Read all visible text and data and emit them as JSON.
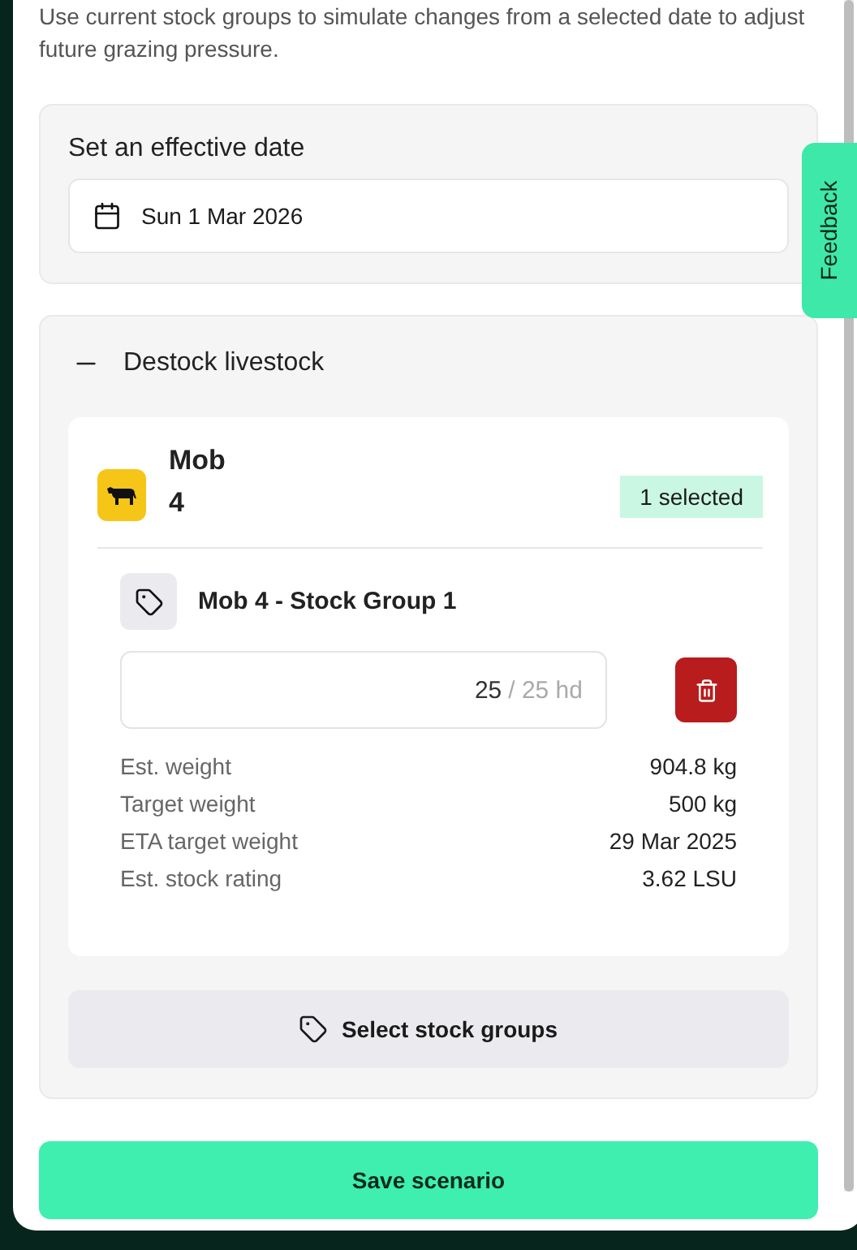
{
  "intro": "Use current stock groups to simulate changes from a selected date to adjust future grazing pressure.",
  "effective_date": {
    "label": "Set an effective date",
    "value": "Sun 1 Mar 2026"
  },
  "destock": {
    "title": "Destock livestock",
    "expanded": true,
    "mob": {
      "name": "Mob 4",
      "badge": "1 selected",
      "stock_groups": [
        {
          "name": "Mob 4 - Stock Group 1",
          "quantity": "25",
          "max": "/ 25 hd",
          "stats": [
            {
              "label": "Est. weight",
              "value": "904.8 kg"
            },
            {
              "label": "Target weight",
              "value": "500 kg"
            },
            {
              "label": "ETA target weight",
              "value": "29 Mar 2025"
            },
            {
              "label": "Est. stock rating",
              "value": "3.62 LSU"
            }
          ]
        }
      ]
    },
    "select_button": "Select stock groups"
  },
  "feedback_tab": "Feedback",
  "save_button": "Save scenario"
}
